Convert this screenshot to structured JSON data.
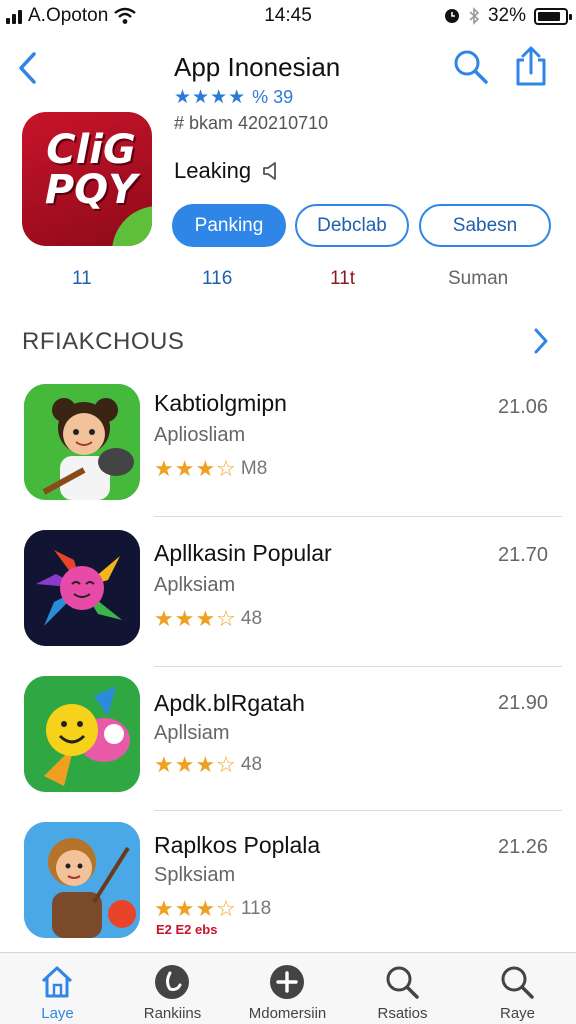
{
  "status_bar": {
    "carrier": "A.Opoton",
    "time": "14:45",
    "battery_percent": "32%",
    "battery_level": 0.85
  },
  "header": {
    "title": "App Inonesian",
    "rating_stars": "★★★★",
    "rating_count": "% 39",
    "subtitle": "# bkam 420210710",
    "icon_text": "CliG PQY"
  },
  "app_status": {
    "label": "Leaking"
  },
  "buttons": {
    "primary": "Panking",
    "secondary": "Debclab",
    "tertiary": "Sabesn"
  },
  "stats": [
    "11",
    "116",
    "11t",
    "Suman"
  ],
  "section": {
    "title": "RFIAKCHOUS"
  },
  "apps": [
    {
      "name": "Kabtiolgmipn",
      "category": "Apliosliam",
      "stars": "★★★☆",
      "score": "M8",
      "price": "21.06",
      "icon": "girl-ukulele-icon"
    },
    {
      "name": "Apllkasin Popular",
      "category": "Aplksiam",
      "stars": "★★★☆",
      "score": "48",
      "price": "21.70",
      "icon": "pinwheel-character-icon"
    },
    {
      "name": "Apdk.blRgatah",
      "category": "Apllsiam",
      "stars": "★★★☆",
      "score": "48",
      "price": "21.90",
      "icon": "smiley-bird-icon"
    },
    {
      "name": "Raplkos Poplala",
      "category": "Splksiam",
      "stars": "★★★☆",
      "score": "118",
      "price": "21.26",
      "icon": "girl-archer-icon",
      "badge": "E2 E2 ebs"
    }
  ],
  "tabs": [
    {
      "label": "Laye",
      "icon": "home-icon",
      "active": true
    },
    {
      "label": "Rankiins",
      "icon": "clock-icon",
      "active": false
    },
    {
      "label": "Mdomersiin",
      "icon": "plus-icon",
      "active": false
    },
    {
      "label": "Rsatios",
      "icon": "search-icon",
      "active": false
    },
    {
      "label": "Raye",
      "icon": "search-icon",
      "active": false
    }
  ],
  "colors": {
    "accent": "#2f86e6",
    "star": "#f0a020",
    "app_icon_red": "#c8142a"
  }
}
